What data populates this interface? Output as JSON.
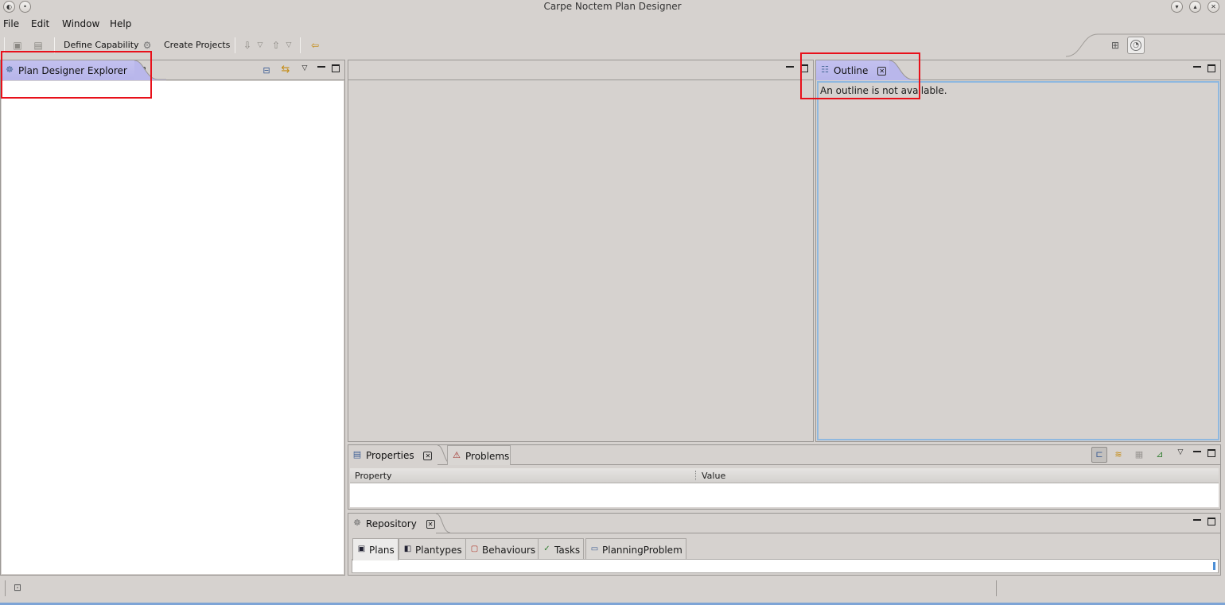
{
  "window": {
    "title": "Carpe Noctem Plan Designer",
    "buttons": [
      "▾",
      "▴",
      "✕"
    ]
  },
  "menu": {
    "file": "File",
    "edit": "Edit",
    "window": "Window",
    "help": "Help"
  },
  "toolbar": {
    "define_capability": "Define Capability",
    "create_projects": "Create Projects"
  },
  "explorer": {
    "tab_label": "Plan Designer Explorer"
  },
  "outline": {
    "tab_label": "Outline",
    "message": "An outline is not available."
  },
  "properties": {
    "tab_label": "Properties",
    "problems_label": "Problems",
    "columns": [
      "Property",
      "Value"
    ]
  },
  "repository": {
    "tab_label": "Repository",
    "tabs": [
      "Plans",
      "Plantypes",
      "Behaviours",
      "Tasks",
      "PlanningProblem"
    ]
  },
  "colors": {
    "active_tab": "#b7b5ea",
    "highlight_box": "#e8101a",
    "background": "#d6d2cf",
    "focus_border": "#8fb8df"
  }
}
